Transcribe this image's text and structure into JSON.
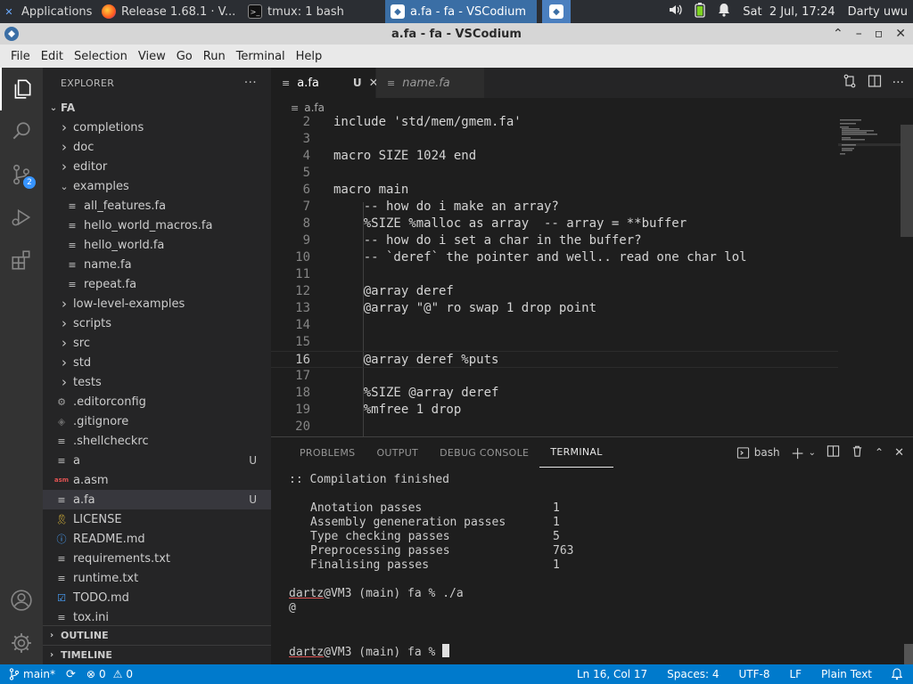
{
  "panel": {
    "tasks": [
      {
        "label": "Applications ☰",
        "icon": "xfce-icon",
        "active": false
      },
      {
        "label": "Release 1.68.1 · V...",
        "icon": "firefox-icon",
        "active": false
      },
      {
        "label": "tmux: 1 bash",
        "icon": "terminal-icon",
        "active": false
      },
      {
        "label": "a.fa - fa - VSCodium",
        "icon": "vscodium-icon",
        "active": true
      }
    ],
    "clock": "Sat  2 Jul, 17:24",
    "user": "Darty uwu"
  },
  "window": {
    "title": "a.fa - fa - VSCodium"
  },
  "menu": [
    "File",
    "Edit",
    "Selection",
    "View",
    "Go",
    "Run",
    "Terminal",
    "Help"
  ],
  "activity": {
    "scm_badge": "2"
  },
  "explorer": {
    "header": "EXPLORER",
    "more": "···",
    "root": "FA",
    "items": [
      {
        "label": "completions",
        "kind": "folder",
        "depth": 1,
        "open": false,
        "git": ""
      },
      {
        "label": "doc",
        "kind": "folder",
        "depth": 1,
        "open": false,
        "git": ""
      },
      {
        "label": "editor",
        "kind": "folder",
        "depth": 1,
        "open": false,
        "git": ""
      },
      {
        "label": "examples",
        "kind": "folder",
        "depth": 1,
        "open": true,
        "git": ""
      },
      {
        "label": "all_features.fa",
        "kind": "file",
        "depth": 2,
        "git": ""
      },
      {
        "label": "hello_world_macros.fa",
        "kind": "file",
        "depth": 2,
        "git": ""
      },
      {
        "label": "hello_world.fa",
        "kind": "file",
        "depth": 2,
        "git": ""
      },
      {
        "label": "name.fa",
        "kind": "file",
        "depth": 2,
        "git": ""
      },
      {
        "label": "repeat.fa",
        "kind": "file",
        "depth": 2,
        "git": ""
      },
      {
        "label": "low-level-examples",
        "kind": "folder",
        "depth": 1,
        "open": false,
        "git": ""
      },
      {
        "label": "scripts",
        "kind": "folder",
        "depth": 1,
        "open": false,
        "git": ""
      },
      {
        "label": "src",
        "kind": "folder",
        "depth": 1,
        "open": false,
        "git": ""
      },
      {
        "label": "std",
        "kind": "folder",
        "depth": 1,
        "open": false,
        "git": ""
      },
      {
        "label": "tests",
        "kind": "folder",
        "depth": 1,
        "open": false,
        "git": ""
      },
      {
        "label": ".editorconfig",
        "kind": "gear",
        "depth": 1,
        "git": ""
      },
      {
        "label": ".gitignore",
        "kind": "git",
        "depth": 1,
        "git": ""
      },
      {
        "label": ".shellcheckrc",
        "kind": "file",
        "depth": 1,
        "git": ""
      },
      {
        "label": "a",
        "kind": "file",
        "depth": 1,
        "git": "U"
      },
      {
        "label": "a.asm",
        "kind": "asm",
        "depth": 1,
        "git": ""
      },
      {
        "label": "a.fa",
        "kind": "file",
        "depth": 1,
        "git": "U",
        "selected": true
      },
      {
        "label": "LICENSE",
        "kind": "license",
        "depth": 1,
        "git": ""
      },
      {
        "label": "README.md",
        "kind": "info",
        "depth": 1,
        "git": ""
      },
      {
        "label": "requirements.txt",
        "kind": "file",
        "depth": 1,
        "git": ""
      },
      {
        "label": "runtime.txt",
        "kind": "file",
        "depth": 1,
        "git": ""
      },
      {
        "label": "TODO.md",
        "kind": "todo",
        "depth": 1,
        "git": ""
      },
      {
        "label": "tox.ini",
        "kind": "file",
        "depth": 1,
        "git": ""
      }
    ],
    "outline": "OUTLINE",
    "timeline": "TIMELINE"
  },
  "editor": {
    "tabs": [
      {
        "label": "a.fa",
        "modified": "U",
        "close": "✕",
        "active": true
      },
      {
        "label": "name.fa",
        "active": false,
        "preview": true
      }
    ],
    "breadcrumb": "a.fa",
    "current_line": 16,
    "lines": [
      {
        "n": "2",
        "text": "include 'std/mem/gmem.fa'"
      },
      {
        "n": "3",
        "text": ""
      },
      {
        "n": "4",
        "text": "macro SIZE 1024 end"
      },
      {
        "n": "5",
        "text": ""
      },
      {
        "n": "6",
        "text": "macro main"
      },
      {
        "n": "7",
        "text": "    -- how do i make an array?"
      },
      {
        "n": "8",
        "text": "    %SIZE %malloc as array  -- array = **buffer"
      },
      {
        "n": "9",
        "text": "    -- how do i set a char in the buffer?"
      },
      {
        "n": "10",
        "text": "    -- `deref` the pointer and well.. read one char lol"
      },
      {
        "n": "11",
        "text": ""
      },
      {
        "n": "12",
        "text": "    @array deref"
      },
      {
        "n": "13",
        "text": "    @array \"@\" ro swap 1 drop point"
      },
      {
        "n": "14",
        "text": ""
      },
      {
        "n": "15",
        "text": ""
      },
      {
        "n": "16",
        "text": "    @array deref %puts"
      },
      {
        "n": "17",
        "text": ""
      },
      {
        "n": "18",
        "text": "    %SIZE @array deref"
      },
      {
        "n": "19",
        "text": "    %mfree 1 drop"
      },
      {
        "n": "20",
        "text": ""
      }
    ]
  },
  "panel_area": {
    "tabs": [
      "PROBLEMS",
      "OUTPUT",
      "DEBUG CONSOLE",
      "TERMINAL"
    ],
    "active_tab": "TERMINAL",
    "shell": "bash",
    "terminal": {
      "header": ":: Compilation finished",
      "stats": [
        {
          "label": "Anotation passes",
          "value": "1"
        },
        {
          "label": "Assembly geneneration passes",
          "value": "1"
        },
        {
          "label": "Type checking passes",
          "value": "5"
        },
        {
          "label": "Preprocessing passes",
          "value": "763"
        },
        {
          "label": "Finalising passes",
          "value": "1"
        }
      ],
      "prompt_user": "dartz",
      "prompt_rest": "@VM3 (main) fa % ",
      "command": "./a",
      "output": "@"
    }
  },
  "status": {
    "branch": "main*",
    "errors": "0",
    "warnings": "0",
    "position": "Ln 16, Col 17",
    "spaces": "Spaces: 4",
    "encoding": "UTF-8",
    "eol": "LF",
    "language": "Plain Text"
  },
  "colors": {
    "accent": "#007acc",
    "activity_bg": "#333333",
    "sidebar_bg": "#252526",
    "editor_bg": "#1e1e1e"
  }
}
